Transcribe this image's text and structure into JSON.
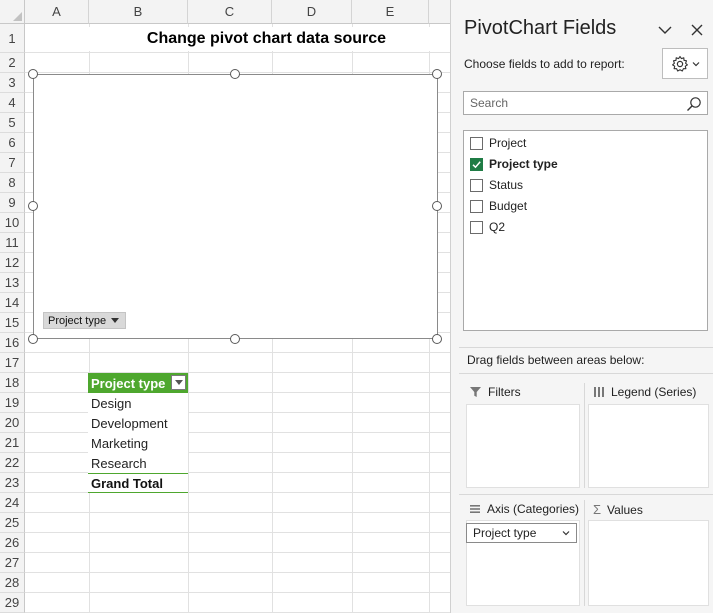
{
  "sheet": {
    "columns": [
      "A",
      "B",
      "C",
      "D",
      "E"
    ],
    "rows": [
      "1",
      "2",
      "3",
      "4",
      "5",
      "6",
      "7",
      "8",
      "9",
      "10",
      "11",
      "12",
      "13",
      "14",
      "15",
      "16",
      "17",
      "18",
      "19",
      "20",
      "21",
      "22",
      "23",
      "24",
      "25",
      "26",
      "27",
      "28",
      "29"
    ],
    "title": "Change pivot chart data source"
  },
  "chart": {
    "field_button": "Project type"
  },
  "pivot_table": {
    "header": "Project type",
    "items": [
      "Design",
      "Development",
      "Marketing",
      "Research"
    ],
    "total": "Grand Total",
    "accent_color": "#4ea72e"
  },
  "pane": {
    "title": "PivotChart Fields",
    "choose_label": "Choose fields to add to report:",
    "search_placeholder": "Search",
    "fields": [
      {
        "label": "Project",
        "checked": false
      },
      {
        "label": "Project type",
        "checked": true
      },
      {
        "label": "Status",
        "checked": false
      },
      {
        "label": "Budget",
        "checked": false
      },
      {
        "label": "Q2",
        "checked": false
      }
    ],
    "drag_label": "Drag fields between areas below:",
    "areas": {
      "filters": "Filters",
      "legend": "Legend (Series)",
      "axis": "Axis (Categories)",
      "values": "Values"
    },
    "axis_chip": "Project type",
    "icons": {
      "chevron": "chevron-down-icon",
      "close": "close-icon",
      "gear": "gear-icon",
      "search": "search-icon",
      "checkbox": "check-icon"
    }
  }
}
